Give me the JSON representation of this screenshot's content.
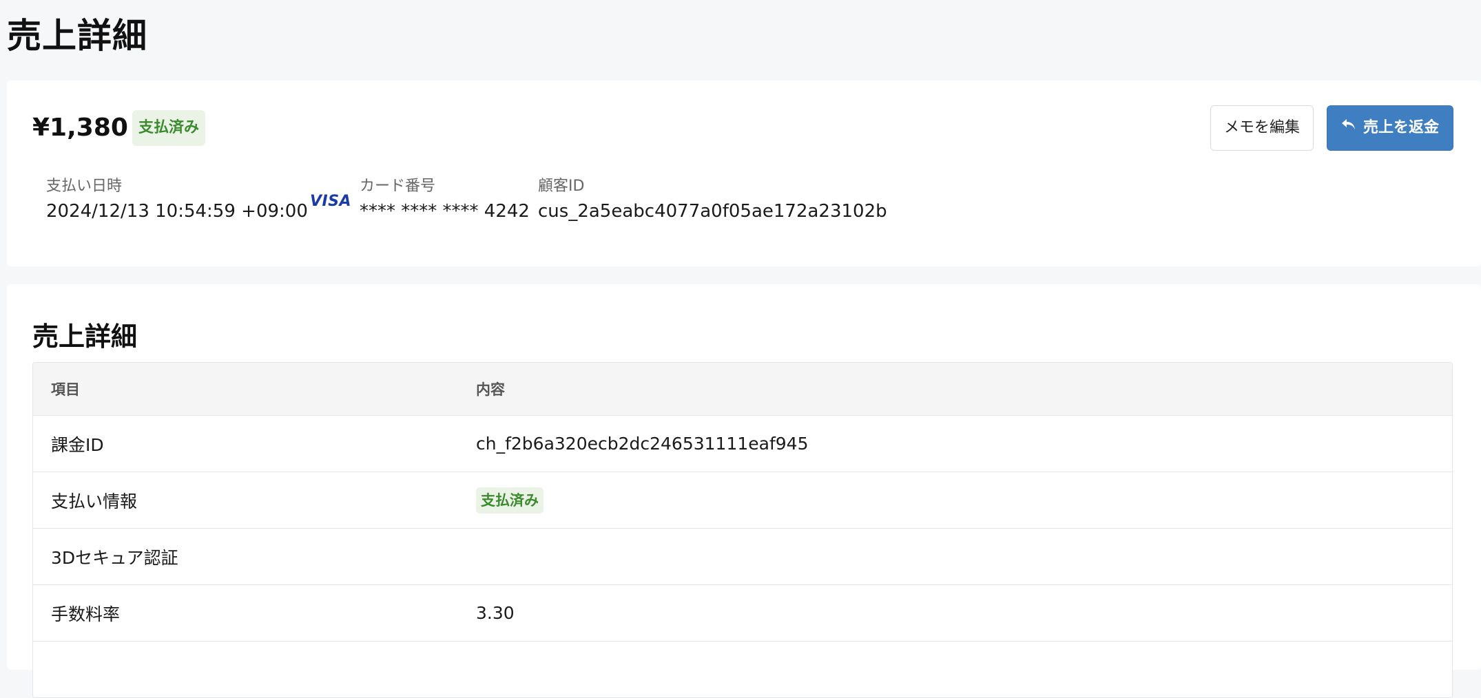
{
  "page": {
    "title": "売上詳細"
  },
  "summary": {
    "amount": "¥1,380",
    "status": "支払済み",
    "buttons": {
      "edit_memo": "メモを編集",
      "refund": "売上を返金"
    },
    "paid_at_label": "支払い日時",
    "paid_at_value": "2024/12/13 10:54:59 +09:00",
    "card_brand": "VISA",
    "card_number_label": "カード番号",
    "card_number_value": "**** **** **** 4242",
    "customer_id_label": "顧客ID",
    "customer_id_value": "cus_2a5eabc4077a0f05ae172a23102b"
  },
  "details": {
    "title": "売上詳細",
    "columns": [
      "項目",
      "内容"
    ],
    "rows": [
      {
        "label": "課金ID",
        "value": "ch_f2b6a320ecb2dc246531111eaf945"
      },
      {
        "label": "支払い情報",
        "value": "支払済み"
      },
      {
        "label": "3Dセキュア認証",
        "value": ""
      },
      {
        "label": "手数料率",
        "value": "3.30"
      }
    ]
  },
  "colors": {
    "accent": "#3f7ec1",
    "status_paid_bg": "#eaf3e6",
    "status_paid_text": "#3c8a2e",
    "visa_blue": "#1a3aa8"
  },
  "icons": {
    "refund": "reply-arrow-icon"
  }
}
